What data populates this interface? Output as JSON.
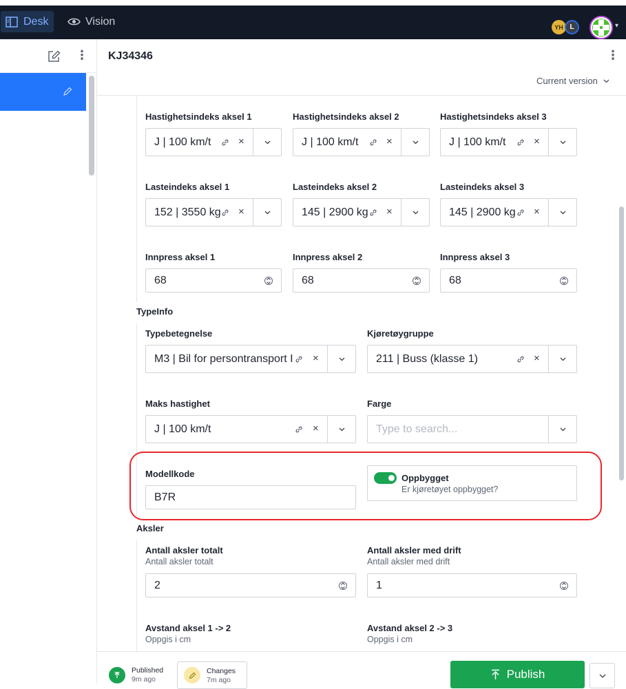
{
  "topbar": {
    "tools": [
      {
        "label": "Desk",
        "icon": "desk-icon",
        "active": true
      },
      {
        "label": "Vision",
        "icon": "eye-icon",
        "active": false
      }
    ],
    "avatars": [
      "YH",
      "L"
    ],
    "accent": "#2276fc"
  },
  "document": {
    "title": "KJ34346",
    "version_label": "Current version"
  },
  "fields": {
    "hastighet_1": {
      "label": "Hastighetsindeks aksel 1",
      "value": "J | 100 km/t"
    },
    "hastighet_2": {
      "label": "Hastighetsindeks aksel 2",
      "value": "J | 100 km/t"
    },
    "hastighet_3": {
      "label": "Hastighetsindeks aksel 3",
      "value": "J | 100 km/t"
    },
    "laste_1": {
      "label": "Lasteindeks aksel 1",
      "value": "152 | 3550 kg"
    },
    "laste_2": {
      "label": "Lasteindeks aksel 2",
      "value": "145 | 2900 kg"
    },
    "laste_3": {
      "label": "Lasteindeks aksel 3",
      "value": "145 | 2900 kg"
    },
    "innpress_1": {
      "label": "Innpress aksel 1",
      "value": "68"
    },
    "innpress_2": {
      "label": "Innpress aksel 2",
      "value": "68"
    },
    "innpress_3": {
      "label": "Innpress aksel 3",
      "value": "68"
    }
  },
  "typeinfo": {
    "title": "TypeInfo",
    "typebetegnelse": {
      "label": "Typebetegnelse",
      "value": "M3 | Bil for persontransport I"
    },
    "kjoretoygruppe": {
      "label": "Kjøretøygruppe",
      "value": "211 | Buss (klasse 1)"
    },
    "maks_hastighet": {
      "label": "Maks hastighet",
      "value": "J | 100 km/t"
    },
    "farge": {
      "label": "Farge",
      "placeholder": "Type to search..."
    },
    "modellkode": {
      "label": "Modellkode",
      "value": "B7R"
    },
    "oppbygget": {
      "label": "Oppbygget",
      "description": "Er kjøretøyet oppbygget?",
      "checked": true
    }
  },
  "aksler": {
    "title": "Aksler",
    "totalt": {
      "label": "Antall aksler totalt",
      "description": "Antall aksler totalt",
      "value": "2"
    },
    "drift": {
      "label": "Antall aksler med drift",
      "description": "Antall aksler med drift",
      "value": "1"
    },
    "avstand_12": {
      "label": "Avstand aksel 1 -> 2",
      "description": "Oppgis i cm"
    },
    "avstand_23": {
      "label": "Avstand aksel 2 -> 3",
      "description": "Oppgis i cm"
    }
  },
  "footer": {
    "published": {
      "label": "Published",
      "time": "9m ago"
    },
    "changes": {
      "label": "Changes",
      "time": "7m ago"
    },
    "publish_label": "Publish"
  }
}
